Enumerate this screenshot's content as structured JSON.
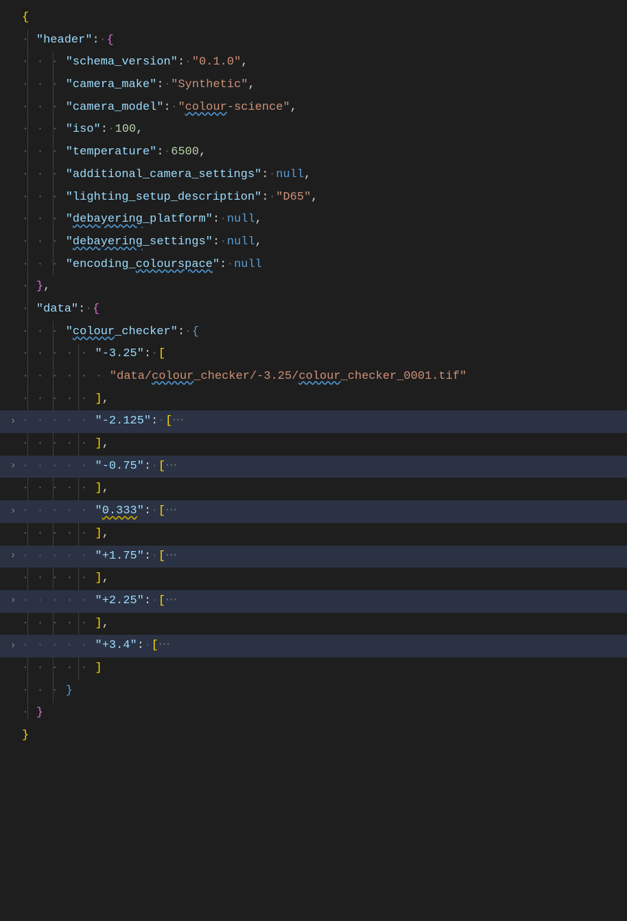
{
  "json": {
    "header": {
      "schema_version": "0.1.0",
      "camera_make": "Synthetic",
      "camera_model": "colour-science",
      "iso": 100,
      "temperature": 6500,
      "additional_camera_settings": null,
      "lighting_setup_description": "D65",
      "debayering_platform": null,
      "debayering_settings": null,
      "encoding_colourspace": null
    },
    "data": {
      "colour_checker": {
        "k_neg_3_25": "-3.25",
        "file_path": "data/colour_checker/-3.25/colour_checker_0001.tif",
        "folded_keys": [
          "-2.125",
          "-0.75",
          "0.333",
          "+1.75",
          "+2.25",
          "+3.4"
        ]
      }
    }
  },
  "tokens": {
    "header": "header",
    "schema_version": "schema_version",
    "camera_make": "camera_make",
    "camera_model": "camera_model",
    "iso": "iso",
    "temperature": "temperature",
    "additional_camera_settings": "additional_camera_settings",
    "lighting_setup_description": "lighting_setup_description",
    "debayering_platform": "debayering_platform",
    "debayering_settings": "debayering_settings",
    "encoding_colourspace": "encoding_colourspace",
    "data": "data",
    "colour_checker": "colour_checker",
    "D65": "D65",
    "null": "null",
    "ellipsis": "⋯"
  }
}
